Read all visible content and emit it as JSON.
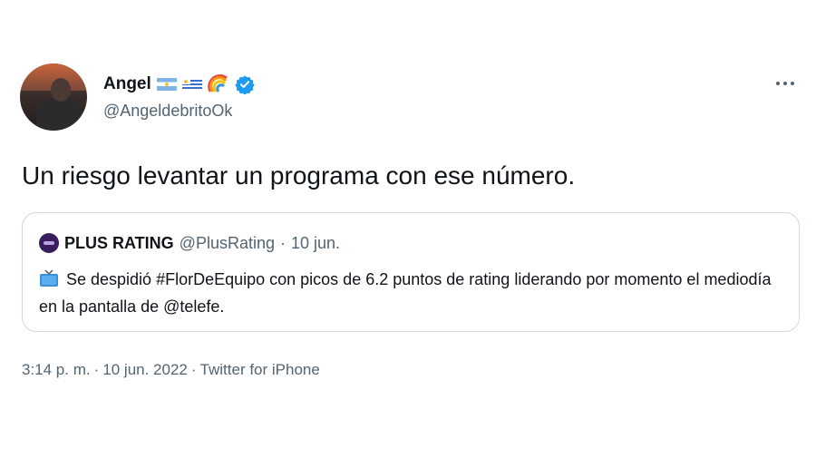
{
  "author": {
    "name": "Angel",
    "handle": "@AngeldebritoOk",
    "badges": [
      "flag-argentina",
      "flag-uruguay",
      "rainbow",
      "verified-badge"
    ]
  },
  "tweet": {
    "text": "Un riesgo levantar un programa con ese número."
  },
  "quoted_tweet": {
    "name": "PLUS RATING",
    "handle": "@PlusRating",
    "separator": "·",
    "date": "10 jun.",
    "icon": "tv-icon",
    "text": "Se despidió #FlorDeEquipo con picos de 6.2 puntos de rating liderando por momento el mediodía en la pantalla de @telefe."
  },
  "meta": {
    "time": "3:14 p. m.",
    "sep1": "·",
    "date": "10 jun. 2022",
    "sep2": "·",
    "source": "Twitter for iPhone"
  },
  "colors": {
    "text": "#0f1419",
    "secondary": "#536471",
    "border": "#cfd9de",
    "verified": "#1d9bf0"
  }
}
